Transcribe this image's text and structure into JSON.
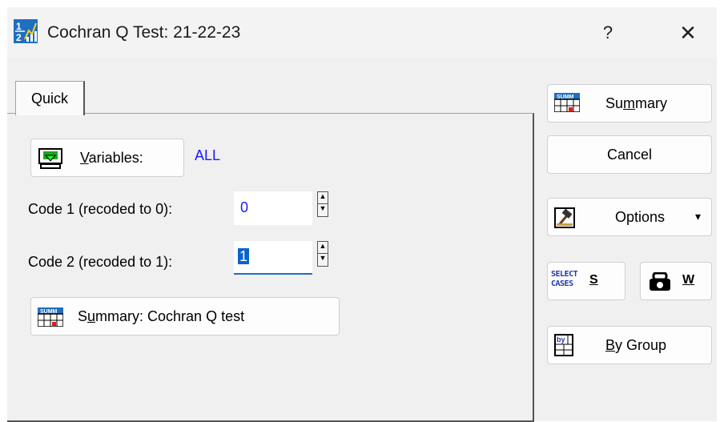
{
  "window": {
    "title": "Cochran Q Test: 21-22-23",
    "help_label": "?",
    "close_label": "✕",
    "icon": "statistics-app-icon"
  },
  "tabs": [
    {
      "label": "Quick"
    }
  ],
  "quick": {
    "variables_button": {
      "pre": "",
      "mnemonic": "V",
      "post": "ariables:",
      "icon": "variables-icon"
    },
    "variables_value": "ALL",
    "code1_label": "Code 1 (recoded to 0):",
    "code1_value": "0",
    "code2_label": "Code 2 (recoded to 1):",
    "code2_value": "1",
    "summary_button": {
      "pre": "S",
      "mnemonic": "u",
      "post": "mmary:  Cochran Q test",
      "icon": "summary-table-icon"
    }
  },
  "side_buttons": {
    "summary": {
      "pre": "Su",
      "mnemonic": "m",
      "post": "mary",
      "icon": "summary-table-icon"
    },
    "cancel": {
      "label": "Cancel"
    },
    "options": {
      "label": "Options",
      "icon": "options-hammer-icon",
      "arrow": "▾"
    },
    "select_cases": {
      "icon_text_top": "SELECT",
      "icon_text_bottom": "CASES",
      "mnemonic": "S"
    },
    "weights": {
      "mnemonic": "W",
      "icon": "weights-icon"
    },
    "by_group": {
      "mnemonic": "B",
      "post": "y Group",
      "icon": "by-group-icon"
    }
  },
  "colors": {
    "accent_value": "#1a1aff",
    "selection": "#0a64c8",
    "dialog_bg": "#f0f0f0"
  }
}
